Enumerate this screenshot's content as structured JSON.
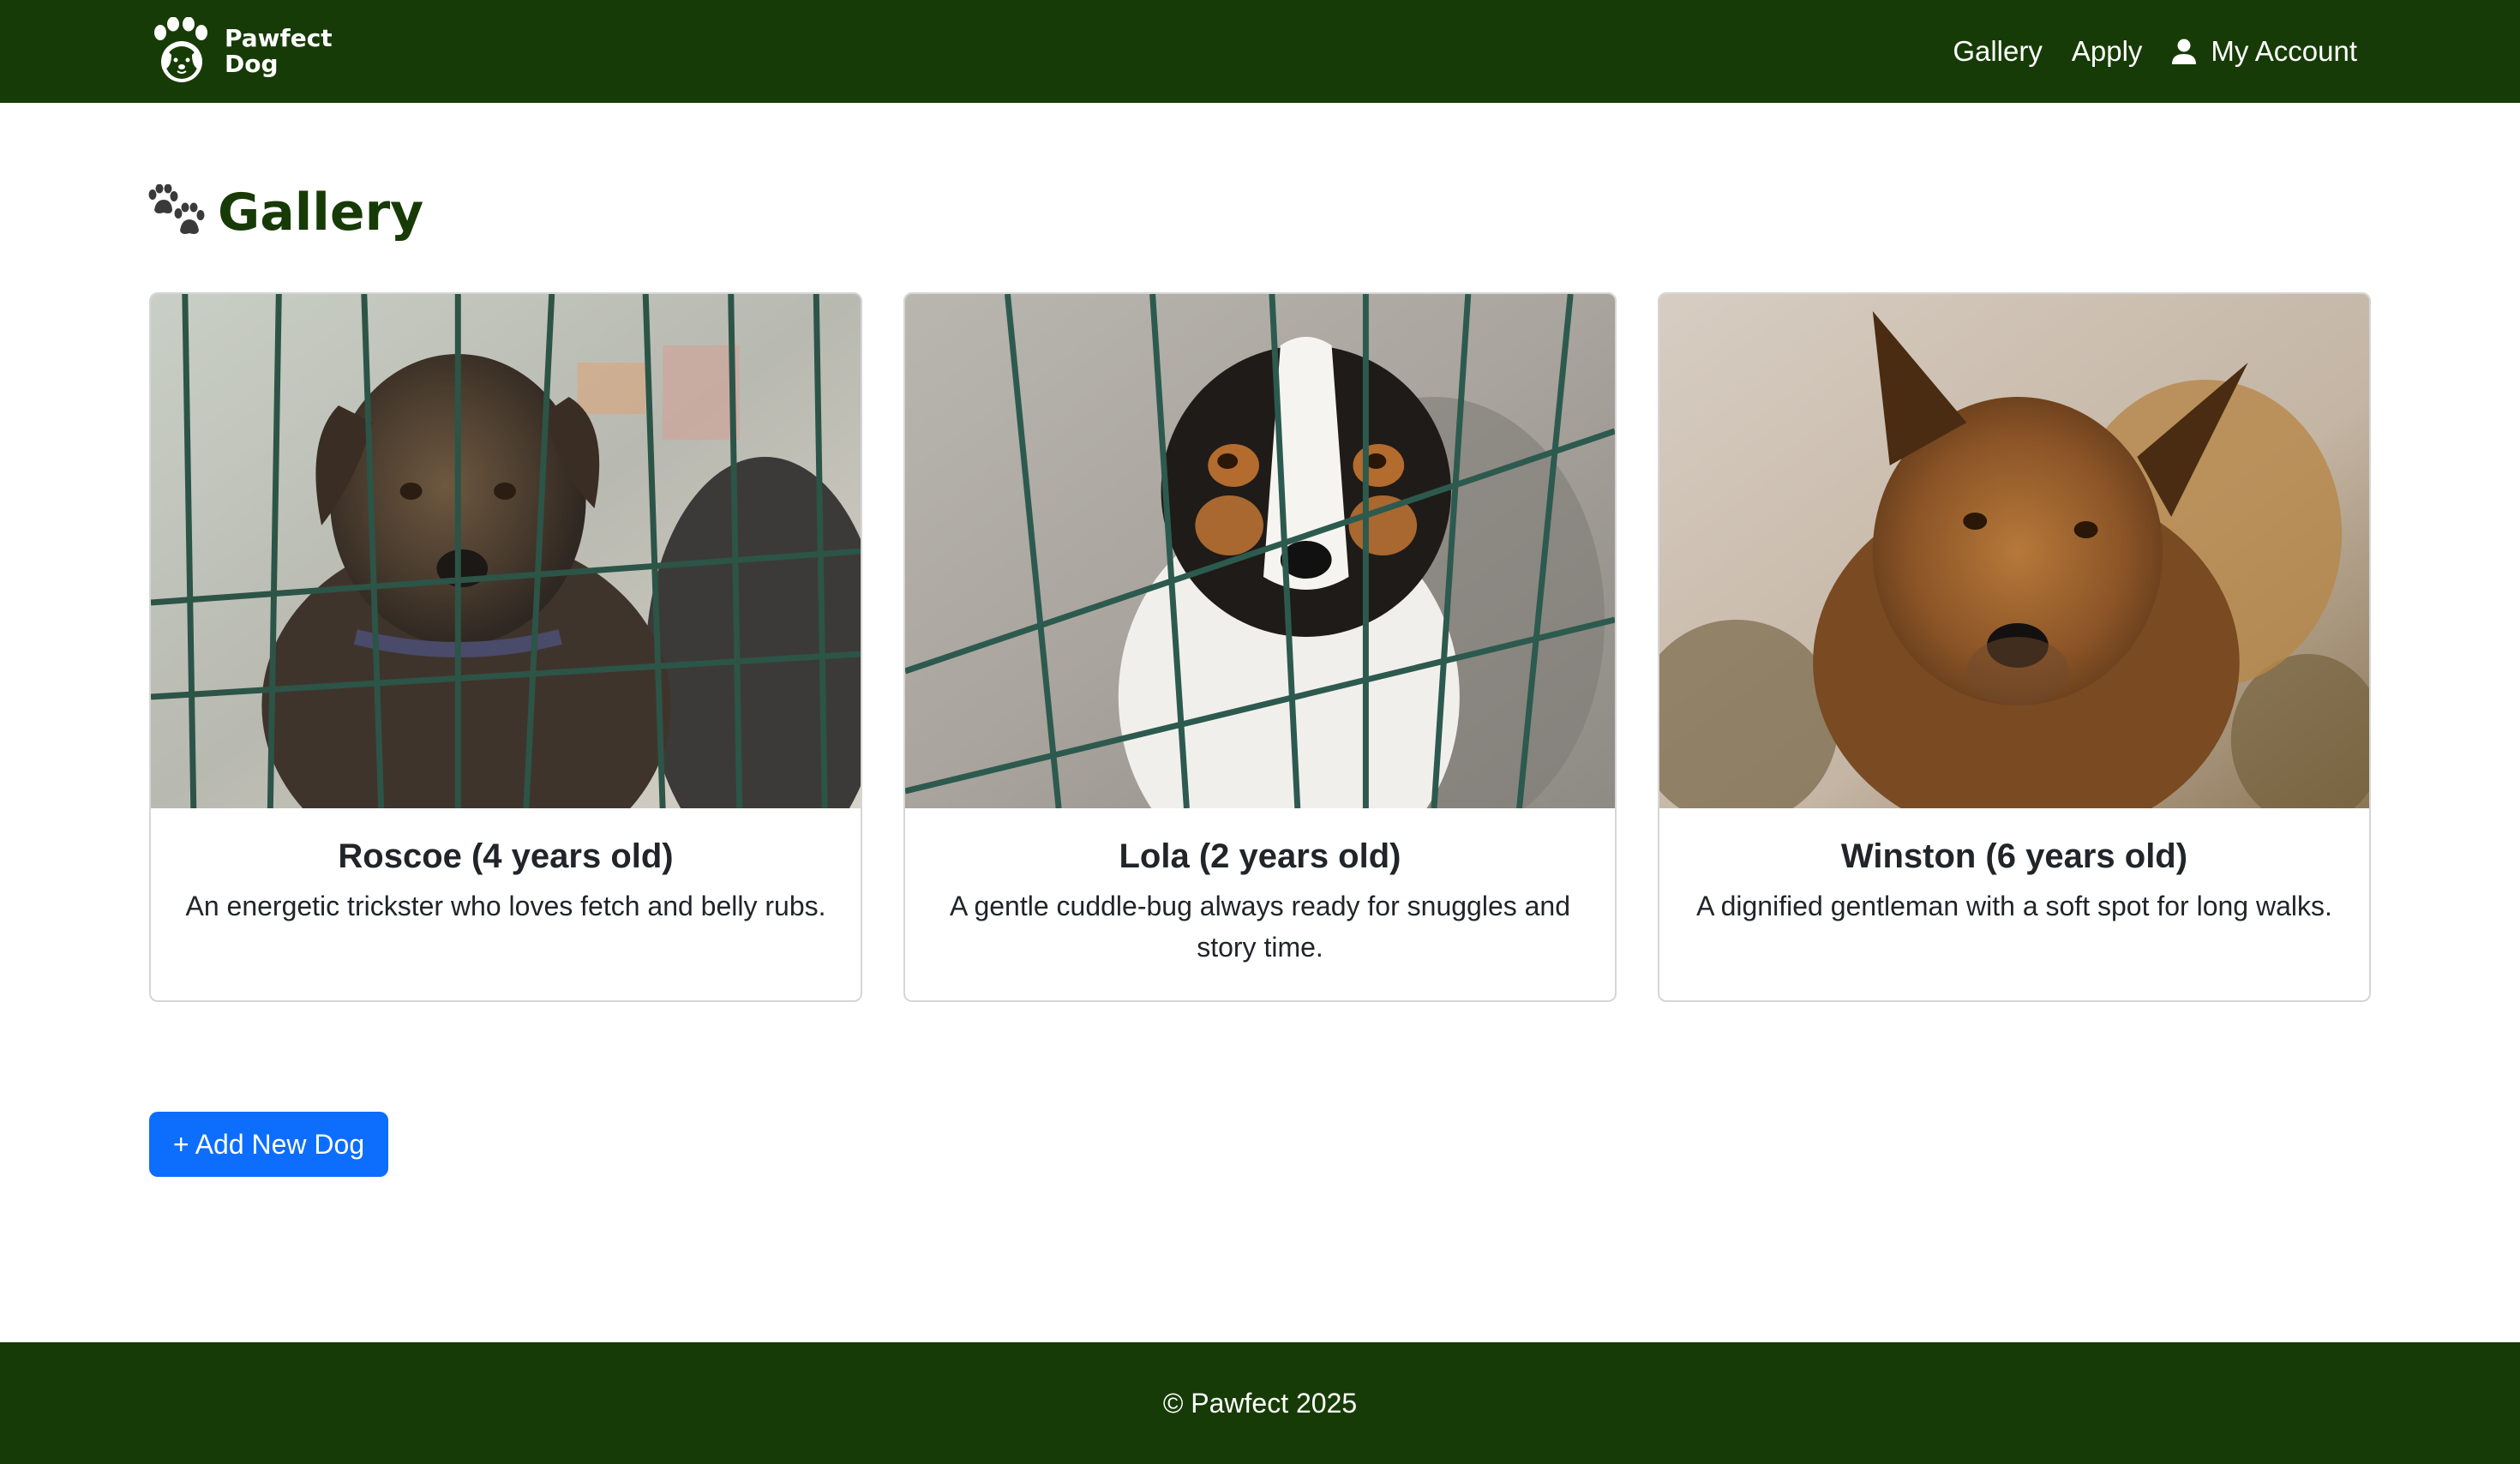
{
  "header": {
    "brand_line1": "Pawfect",
    "brand_line2": "Dog",
    "logo_icon": "dog-paw-logo-icon",
    "nav": [
      {
        "label": "Gallery"
      },
      {
        "label": "Apply"
      },
      {
        "label": "My Account",
        "icon": "user-icon"
      }
    ]
  },
  "main": {
    "title": "Gallery",
    "title_icon": "paws-icon"
  },
  "dogs": [
    {
      "name": "Roscoe (4 years old)",
      "description": "An energetic trickster who loves fetch and belly rubs."
    },
    {
      "name": "Lola (2 years old)",
      "description": "A gentle cuddle-bug always ready for snuggles and story time."
    },
    {
      "name": "Winston (6 years old)",
      "description": "A dignified gentleman with a soft spot for long walks."
    }
  ],
  "actions": {
    "add_dog_label": "+ Add New Dog"
  },
  "footer": {
    "text": "© Pawfect 2025"
  },
  "colors": {
    "brand_green": "#173b06",
    "primary_button": "#0d6efd"
  }
}
